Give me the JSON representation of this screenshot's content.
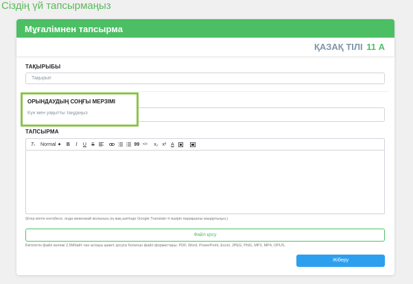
{
  "page": {
    "title": "Сіздің үй тапсырмаңыз"
  },
  "card": {
    "header": "Мұғалімнен тапсырма",
    "subject": "ҚАЗАҚ ТІЛІ",
    "grade": "11 А"
  },
  "topic": {
    "label": "ТАҚЫРЫБЫ",
    "placeholder": "Тақырып"
  },
  "deadline": {
    "label": "ОРЫНДАУДЫҢ СОҢҒЫ МЕРЗІМІ",
    "placeholder": "Күн мен уақытты таңдаңыз"
  },
  "task": {
    "label": "ТАПСЫРМА",
    "toolbar": {
      "font_size": "Normal",
      "bold": "B",
      "italic": "I",
      "underline": "U",
      "strike": "S",
      "quote": "99",
      "code": "</>",
      "subscript": "x₂",
      "superscript": "x²",
      "color": "A"
    },
    "hint": "(Егер мәтін енгізбесе, онда мекенжай жолының оң жақ шетінде Google Translate-ті өшіріп парақшаны жаңартыңыз.)"
  },
  "file": {
    "button_label": "Файл қосу",
    "hint": "Біктілетін файл көлемі 2,5Мбайт-тан аспауы қажет, қосуға болатын файл форматтары: PDF, Word, PowerPoint, Excel, JPEG, PNG, MP3, MP4, OPUS."
  },
  "submit": {
    "label": "Жіберу"
  },
  "colors": {
    "accent_green": "#4cbf64",
    "highlight_green": "#8bc34a",
    "submit_blue": "#2d9fef"
  }
}
